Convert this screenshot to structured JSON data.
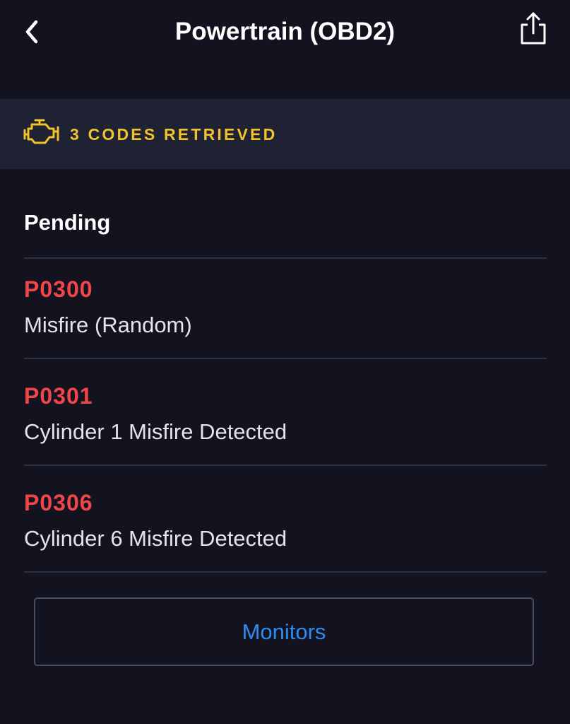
{
  "header": {
    "title": "Powertrain (OBD2)",
    "back_icon": "chevron-left-icon",
    "share_icon": "share-icon"
  },
  "banner": {
    "icon": "check-engine-icon",
    "text": "3 CODES RETRIEVED",
    "color": "#f2c12e"
  },
  "section": {
    "heading": "Pending"
  },
  "codes": [
    {
      "code": "P0300",
      "description": "Misfire (Random)"
    },
    {
      "code": "P0301",
      "description": "Cylinder 1 Misfire Detected"
    },
    {
      "code": "P0306",
      "description": "Cylinder 6 Misfire Detected"
    }
  ],
  "colors": {
    "background": "#12131f",
    "banner_bg": "#1f2232",
    "code_red": "#f2454a",
    "link_blue": "#2d8cf0"
  },
  "footer": {
    "monitors_label": "Monitors"
  }
}
